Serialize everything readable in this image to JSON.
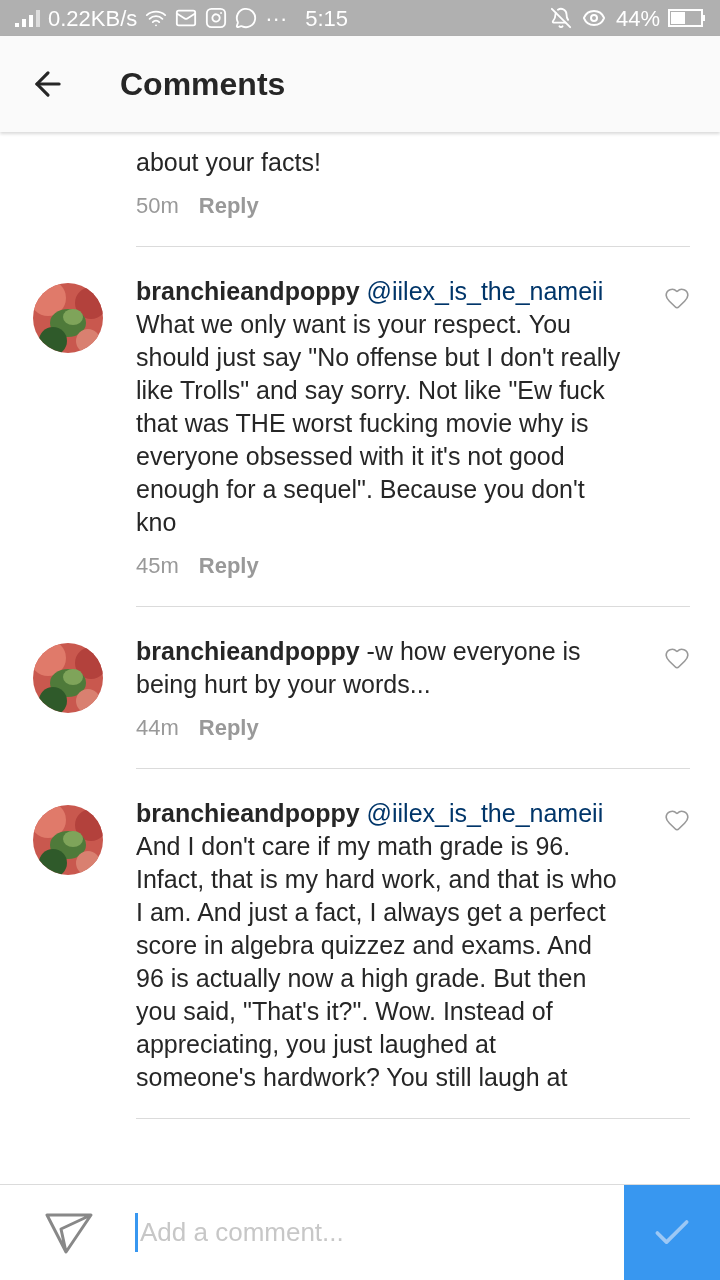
{
  "status_bar": {
    "speed": "0.22KB/s",
    "more": "···",
    "time": "5:15",
    "battery": "44%"
  },
  "header": {
    "title": "Comments"
  },
  "comments": [
    {
      "text": "about your facts!",
      "time": "50m",
      "reply": "Reply"
    },
    {
      "username": "branchieandpoppy",
      "mention": "@iilex_is_the_nameii",
      "text": "What we only want is your respect. You should just say \"No offense but I don't really like Trolls\" and say sorry. Not like \"Ew fuck that was THE worst fucking movie why is everyone obsessed with it it's not good enough for a sequel\". Because you don't kno",
      "time": "45m",
      "reply": "Reply",
      "liked": false
    },
    {
      "username": "branchieandpoppy",
      "text": "-w how everyone is being hurt by your words...",
      "time": "44m",
      "reply": "Reply",
      "liked": false
    },
    {
      "username": "branchieandpoppy",
      "mention": "@iilex_is_the_nameii",
      "text": "And I don't care if my math grade is 96. Infact, that is my hard work, and that is who I am. And just a fact, I always get a perfect score in algebra quizzez and exams. And 96 is actually now a high grade. But then you said, \"That's it?\". Wow. Instead of appreciating, you just laughed at someone's hardwork? You still laugh at",
      "liked": false
    }
  ],
  "composer": {
    "placeholder": "Add a comment..."
  }
}
